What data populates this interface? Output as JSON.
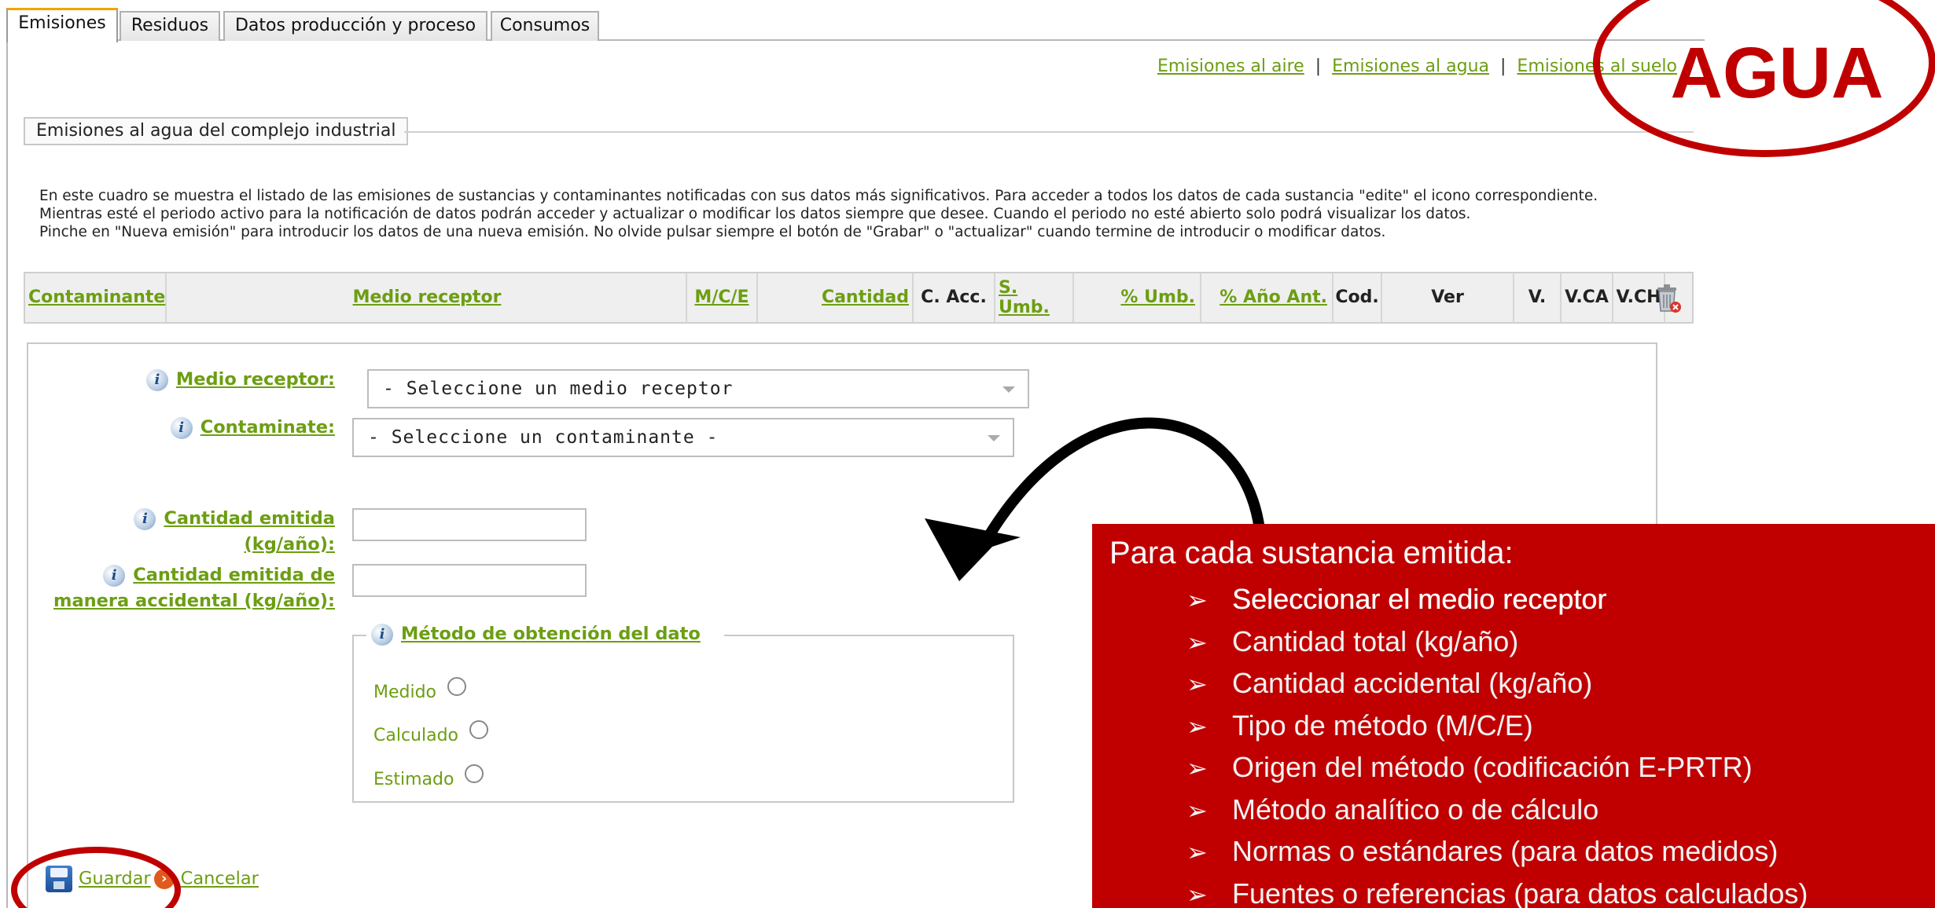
{
  "tabs": [
    {
      "label": "Emisiones",
      "active": true
    },
    {
      "label": "Residuos",
      "active": false
    },
    {
      "label": "Datos producción y proceso",
      "active": false
    },
    {
      "label": "Consumos",
      "active": false
    }
  ],
  "top_links": {
    "air": "Emisiones al aire",
    "separator": "|",
    "water": "Emisiones al agua",
    "soil": "Emisiones al suelo"
  },
  "section_title": "Emisiones al agua del complejo industrial",
  "intro_lines": [
    "En este cuadro se muestra el listado de las emisiones de sustancias y contaminantes notificadas con sus datos más significativos. Para acceder a todos los datos de cada sustancia \"edite\" el icono correspondiente.",
    "Mientras esté el periodo activo para la notificación de datos podrán acceder y actualizar o modificar los datos siempre que desee. Cuando el periodo no esté abierto solo podrá visualizar los datos.",
    "Pinche en \"Nueva emisión\" para introducir los datos de una nueva emisión. No olvide pulsar siempre el botón de \"Grabar\" o \"actualizar\" cuando termine de introducir o modificar datos."
  ],
  "table_headers": {
    "contaminante": "Contaminante",
    "medio": "Medio receptor",
    "mce": "M/C/E",
    "cantidad": "Cantidad",
    "cacc": "C. Acc.",
    "sumb1": "S.",
    "sumb2": "Umb.",
    "pumb": "% Umb.",
    "pano": "% Año Ant.",
    "cod": "Cod.",
    "ver": "Ver",
    "v": "V.",
    "vca": "V.CA",
    "vch": "V.CH"
  },
  "form": {
    "medio_label": "Medio receptor:",
    "medio_value": "- Seleccione un medio receptor",
    "contaminante_label": "Contaminate:",
    "contaminante_value": "- Seleccione un contaminante -",
    "cantidad_label_1": "Cantidad emitida",
    "cantidad_label_2": "(kg/año):",
    "accidental_label_1": "Cantidad emitida de",
    "accidental_label_2": "manera accidental (kg/año):",
    "cantidad_value": "",
    "accidental_value": "",
    "metodo_legend": "Método de obtención del dato",
    "metodo_options": [
      "Medido",
      "Calculado",
      "Estimado"
    ]
  },
  "actions": {
    "save": "Guardar",
    "cancel": "Cancelar"
  },
  "overlay": {
    "badge": "AGUA",
    "panel_title": "Para cada sustancia emitida:",
    "bullet_mark": "➢",
    "bullets": [
      "Seleccionar el medio receptor",
      "Cantidad total (kg/año)",
      "Cantidad accidental (kg/año)",
      "Tipo de método (M/C/E)",
      "Origen del método (codificación E-PRTR)",
      "Método analítico o de cálculo",
      "Normas o estándares (para datos medidos)",
      "Fuentes o referencias (para datos calculados)"
    ]
  },
  "colors": {
    "link": "#6c9e12",
    "accent_red": "#c00000",
    "tab_active_top": "#f1a300"
  },
  "icons": {
    "info": "info-icon",
    "trash": "trash-icon",
    "save": "save-icon",
    "arrow": "curved-arrow-icon"
  }
}
